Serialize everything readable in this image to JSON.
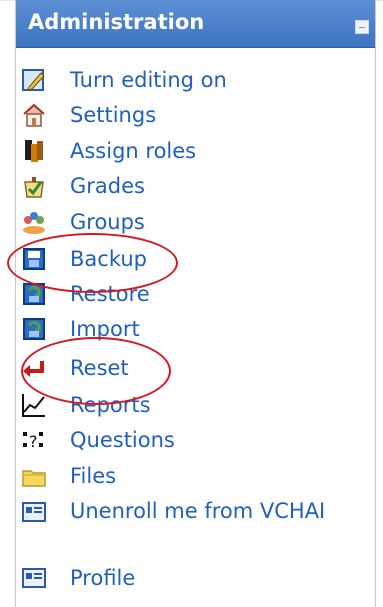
{
  "block": {
    "title": "Administration",
    "collapse_icon": "minus-square-icon",
    "items": [
      {
        "label": "Turn editing on",
        "icon": "pencil-edit-icon"
      },
      {
        "label": "Settings",
        "icon": "house-settings-icon"
      },
      {
        "label": "Assign roles",
        "icon": "roles-people-icon"
      },
      {
        "label": "Grades",
        "icon": "grades-icon"
      },
      {
        "label": "Groups",
        "icon": "groups-people-icon"
      },
      {
        "label": "Backup",
        "icon": "floppy-disk-icon"
      },
      {
        "label": "Restore",
        "icon": "restore-disk-icon"
      },
      {
        "label": "Import",
        "icon": "import-disk-icon"
      },
      {
        "label": "Reset",
        "icon": "red-arrow-reset-icon"
      },
      {
        "label": "Reports",
        "icon": "line-graph-icon"
      },
      {
        "label": "Questions",
        "icon": "questions-icon"
      },
      {
        "label": "Files",
        "icon": "folder-icon"
      },
      {
        "label": "Unenroll me from VCHAI",
        "icon": "id-card-icon"
      },
      {
        "label": "Profile",
        "icon": "id-card-icon"
      }
    ]
  },
  "annotations": {
    "highlight_color": "#d7181f",
    "highlighted_items": [
      "Backup",
      "Reset"
    ]
  }
}
